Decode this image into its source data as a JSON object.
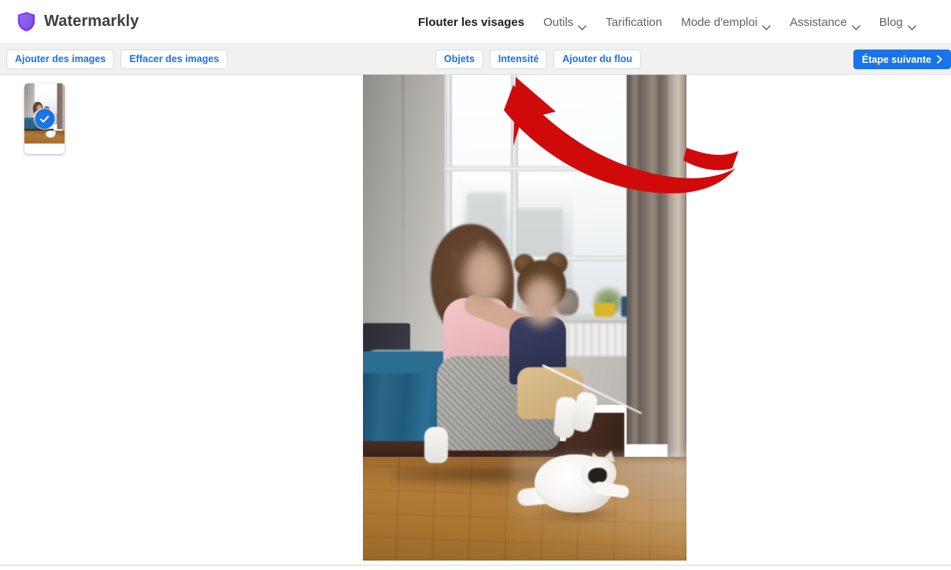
{
  "brand": {
    "name": "Watermarkly",
    "icon": "shield-icon",
    "color": "#7b4fe0"
  },
  "nav": {
    "items": [
      {
        "label": "Flouter les visages",
        "active": true,
        "has_dropdown": false
      },
      {
        "label": "Outils",
        "active": false,
        "has_dropdown": true
      },
      {
        "label": "Tarification",
        "active": false,
        "has_dropdown": false
      },
      {
        "label": "Mode d'emploi",
        "active": false,
        "has_dropdown": true
      },
      {
        "label": "Assistance",
        "active": false,
        "has_dropdown": true
      },
      {
        "label": "Blog",
        "active": false,
        "has_dropdown": true
      }
    ]
  },
  "toolbar": {
    "left": [
      {
        "label": "Ajouter des images",
        "name": "add-images-button"
      },
      {
        "label": "Effacer des images",
        "name": "clear-images-button"
      }
    ],
    "center": [
      {
        "label": "Objets",
        "name": "objects-button"
      },
      {
        "label": "Intensité",
        "name": "intensity-button"
      },
      {
        "label": "Ajouter du flou",
        "name": "add-blur-button"
      }
    ],
    "next_step": {
      "label": "Étape suivante",
      "chevron": "chevron-right-icon",
      "color": "#1a73e8"
    }
  },
  "sidebar": {
    "thumbnails": [
      {
        "name": "image-thumbnail-1",
        "selected": true,
        "badge": "check-icon"
      }
    ]
  },
  "canvas": {
    "image_alt": "Deux enfants assises sur un lit, visages floutés, avec un chat blanc sur le parquet",
    "annotation": {
      "type": "curved-arrow",
      "color": "#d00a0a",
      "points_to": "Intensité"
    }
  },
  "colors": {
    "accent": "#1a73e8",
    "toolbar_bg": "#f1f1f1",
    "header_bg": "#ffffff",
    "nav_text": "#5f6368",
    "nav_active_text": "#202124",
    "annotation_red": "#d00a0a"
  }
}
